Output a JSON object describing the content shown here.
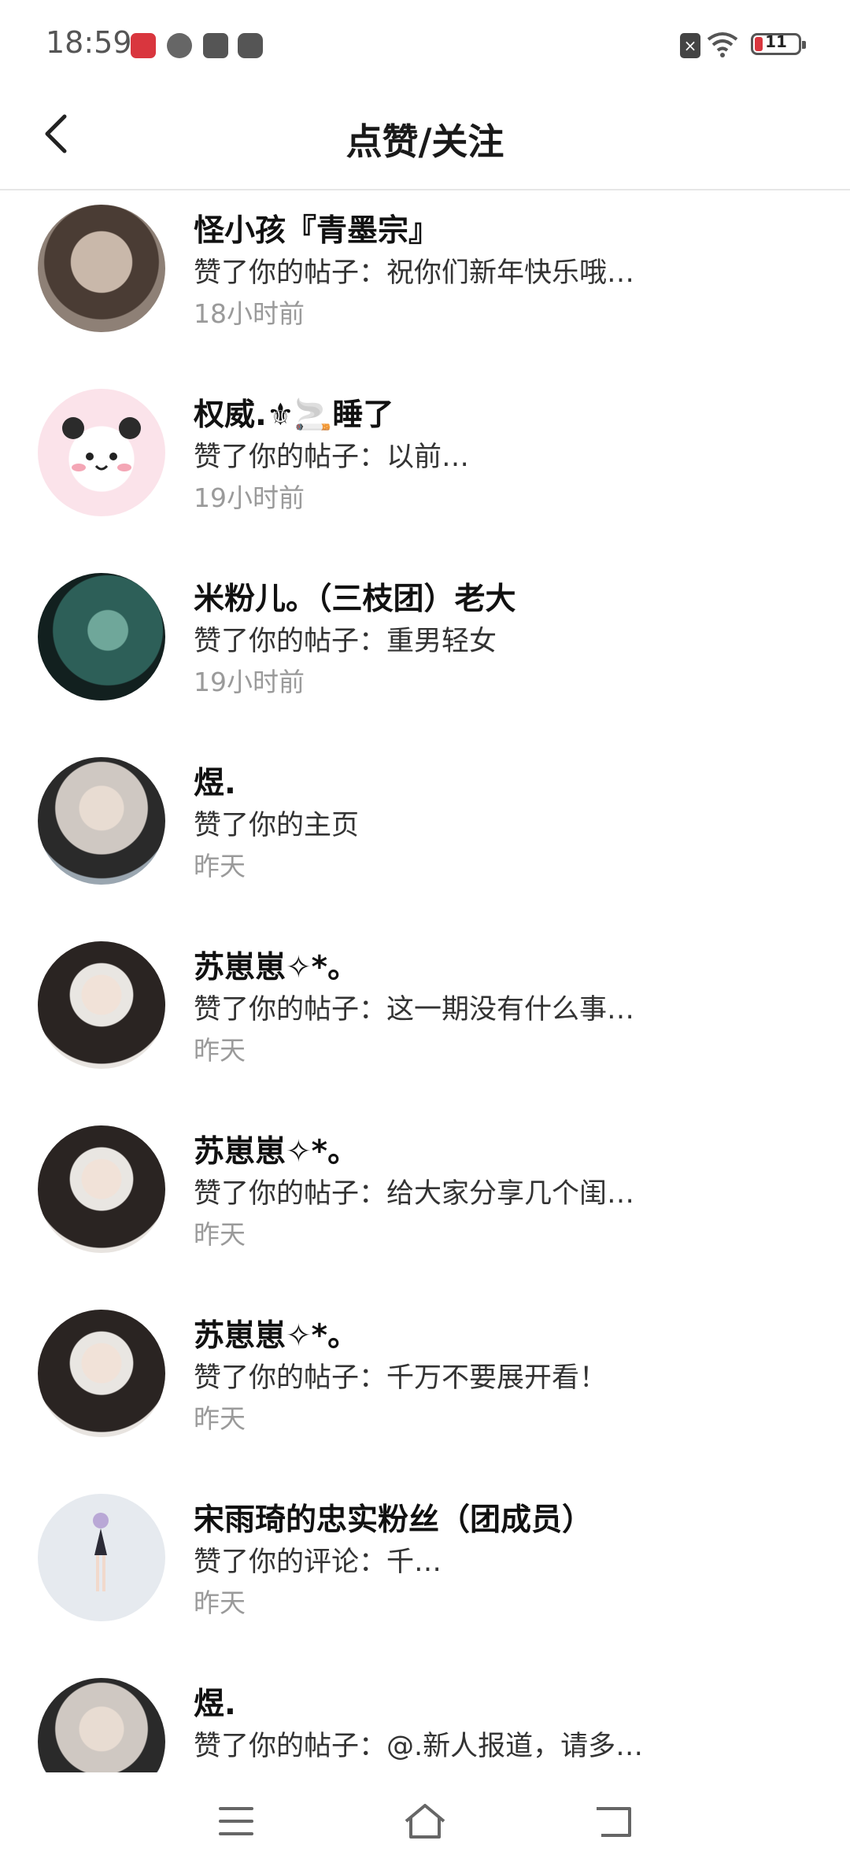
{
  "status_bar": {
    "time": "18:59",
    "battery_level": "11",
    "icons": [
      "app-red-icon",
      "app-leaf-icon",
      "mail-icon",
      "play-icon",
      "sim-off-icon",
      "wifi-icon",
      "battery-icon"
    ]
  },
  "header": {
    "title": "点赞/关注",
    "back_icon": "chevron-left-icon"
  },
  "notifications": [
    {
      "name": "怪小孩『青墨宗』",
      "message": "赞了你的帖子：祝你们新年快乐哦…",
      "time": "18小时前",
      "avatar_color": "#7a6a60"
    },
    {
      "name": "权威.⚜🚬睡了",
      "message": "赞了你的帖子：以前…",
      "time": "19小时前",
      "avatar_color": "#fbe3ea"
    },
    {
      "name": "米粉儿。（三枝团）老大",
      "message": "赞了你的帖子：重男轻女",
      "time": "19小时前",
      "avatar_color": "#1f4a46"
    },
    {
      "name": "煜.",
      "message": "赞了你的主页",
      "time": "昨天",
      "avatar_color": "#b9b6b4"
    },
    {
      "name": "苏崽崽✧*。",
      "message": "赞了你的帖子：这一期没有什么事…",
      "time": "昨天",
      "avatar_color": "#3a3432"
    },
    {
      "name": "苏崽崽✧*。",
      "message": "赞了你的帖子：给大家分享几个闺…",
      "time": "昨天",
      "avatar_color": "#3a3432"
    },
    {
      "name": "苏崽崽✧*。",
      "message": "赞了你的帖子：千万不要展开看！",
      "time": "昨天",
      "avatar_color": "#3a3432"
    },
    {
      "name": "宋雨琦的忠实粉丝（团成员）",
      "message": "赞了你的评论：千…",
      "time": "昨天",
      "avatar_color": "#e6eaef"
    },
    {
      "name": "煜.",
      "message": "赞了你的帖子：@.新人报道，请多…",
      "time": "",
      "avatar_color": "#b9b6b4"
    }
  ],
  "nav_bar": {
    "icons": [
      "menu-icon",
      "home-icon",
      "back-icon"
    ]
  }
}
